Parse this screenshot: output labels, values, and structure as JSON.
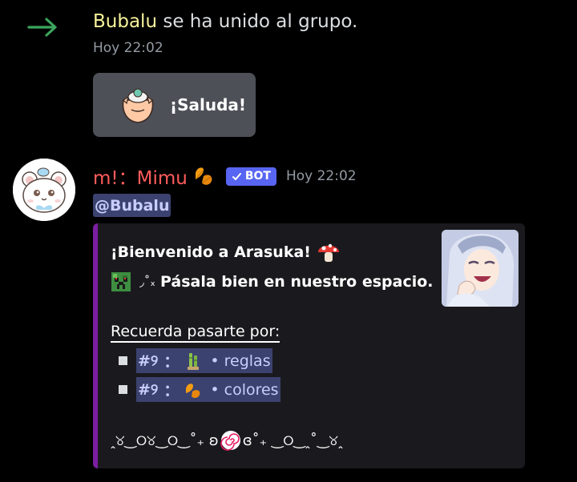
{
  "join": {
    "username": "Bubalu",
    "text": " se ha unido al grupo.",
    "time": "Hoy 22:02",
    "wave_button_label": "¡Saluda!"
  },
  "message": {
    "author": "m!：Mimu",
    "bot_tag": "BOT",
    "time": "Hoy 22:02",
    "mention": "@Bubalu",
    "embed": {
      "title": "¡Bienvenido a Arasuka!",
      "kaomoji": "◞˚ₓ",
      "line1": "Pásala bien en nuestro espacio.",
      "recuerda": "Recuerda pasarte por:",
      "channels": [
        {
          "prefix": "#୨",
          "sep": "：",
          "name": "reglas",
          "icon": "bamboo-icon"
        },
        {
          "prefix": "#୨",
          "sep": "：",
          "name": "colores",
          "icon": "leaf-icon"
        }
      ],
      "footer_left": "ꞈ୪‿୦୪‿୦‿˚₊ ʚ",
      "footer_right": "ɞ˚₊ ‿୦‿ꞈ˚‿୪ꞈ"
    }
  },
  "colors": {
    "background": "#000000",
    "join_username": "#f8f39b",
    "join_arrow": "#3ba55d",
    "author": "#ff5b5b",
    "bot_tag": "#5865f2",
    "embed_bar": "#7b1fa2",
    "mention_bg": "#3c4270",
    "mention_text": "#c9cdfb"
  }
}
